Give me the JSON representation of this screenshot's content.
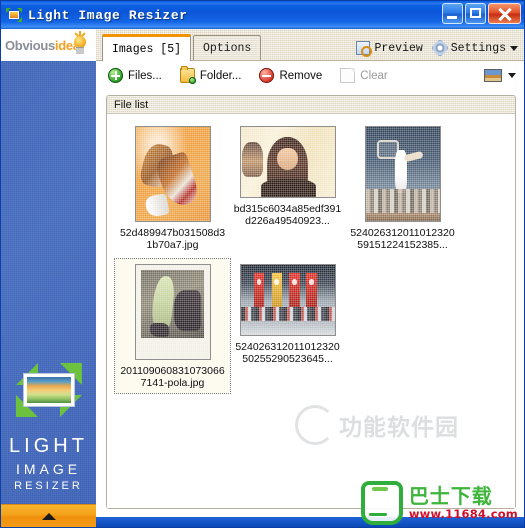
{
  "window": {
    "title": "Light Image Resizer",
    "icon": "app-logo-icon",
    "caption_buttons": [
      {
        "name": "minimize",
        "label": "Minimize"
      },
      {
        "name": "maximize",
        "label": "Maximize"
      },
      {
        "name": "close",
        "label": "Close"
      }
    ]
  },
  "sidebar": {
    "brand": {
      "part1": "Obvious",
      "part2": "idea",
      "icon": "lightbulb-icon"
    },
    "product": {
      "line1": "LIGHT",
      "line2": "IMAGE",
      "line3": "RESIZER"
    },
    "collapse": {
      "icon": "chevron-up-icon",
      "label": "Collapse"
    }
  },
  "tabs": [
    {
      "label": "Images [5]",
      "active": true
    },
    {
      "label": "Options",
      "active": false
    }
  ],
  "tabbar_right": [
    {
      "label": "Preview",
      "icon": "preview-icon"
    },
    {
      "label": "Settings",
      "icon": "gear-icon",
      "has_caret": true
    }
  ],
  "toolbar": {
    "buttons": [
      {
        "label": "Files...",
        "icon": "add-files-icon",
        "enabled": true
      },
      {
        "label": "Folder...",
        "icon": "add-folder-icon",
        "enabled": true
      },
      {
        "label": "Remove",
        "icon": "remove-icon",
        "enabled": true
      },
      {
        "label": "Clear",
        "icon": "clear-icon",
        "enabled": false
      }
    ],
    "view_mode": {
      "icon": "thumbnail-view-icon",
      "caret": "chevron-down-icon"
    }
  },
  "file_list": {
    "group_label": "File list",
    "items": [
      {
        "caption": "52d489947b031508d31b70a7.jpg",
        "art": "art-shoe",
        "orientation": "portrait",
        "selected": false
      },
      {
        "caption": "bd315c6034a85edf391d226a49540923...",
        "art": "art-girl",
        "orientation": "landscape",
        "selected": false
      },
      {
        "caption": "52402631201101232059151224152385...",
        "art": "art-ball",
        "orientation": "portrait",
        "selected": false
      },
      {
        "caption": "2011090608310730667141-pola.jpg",
        "art": "art-pola",
        "orientation": "portrait",
        "selected": true
      },
      {
        "caption": "52402631201101232050255290523645...",
        "art": "art-flags",
        "orientation": "landscape",
        "selected": false
      }
    ]
  },
  "watermarks": {
    "primary": "功能软件园",
    "brand_cn": "巴士下载",
    "brand_url": "www.11684.com"
  },
  "colors": {
    "title_bar": "#0c56d8",
    "accent_orange": "#f29400",
    "sidebar": "#4166ba",
    "tab_active": "#ffffff",
    "tabstrip": "#ece7d9",
    "brand_green": "#3fb53c",
    "brand_red": "#d0102a"
  }
}
